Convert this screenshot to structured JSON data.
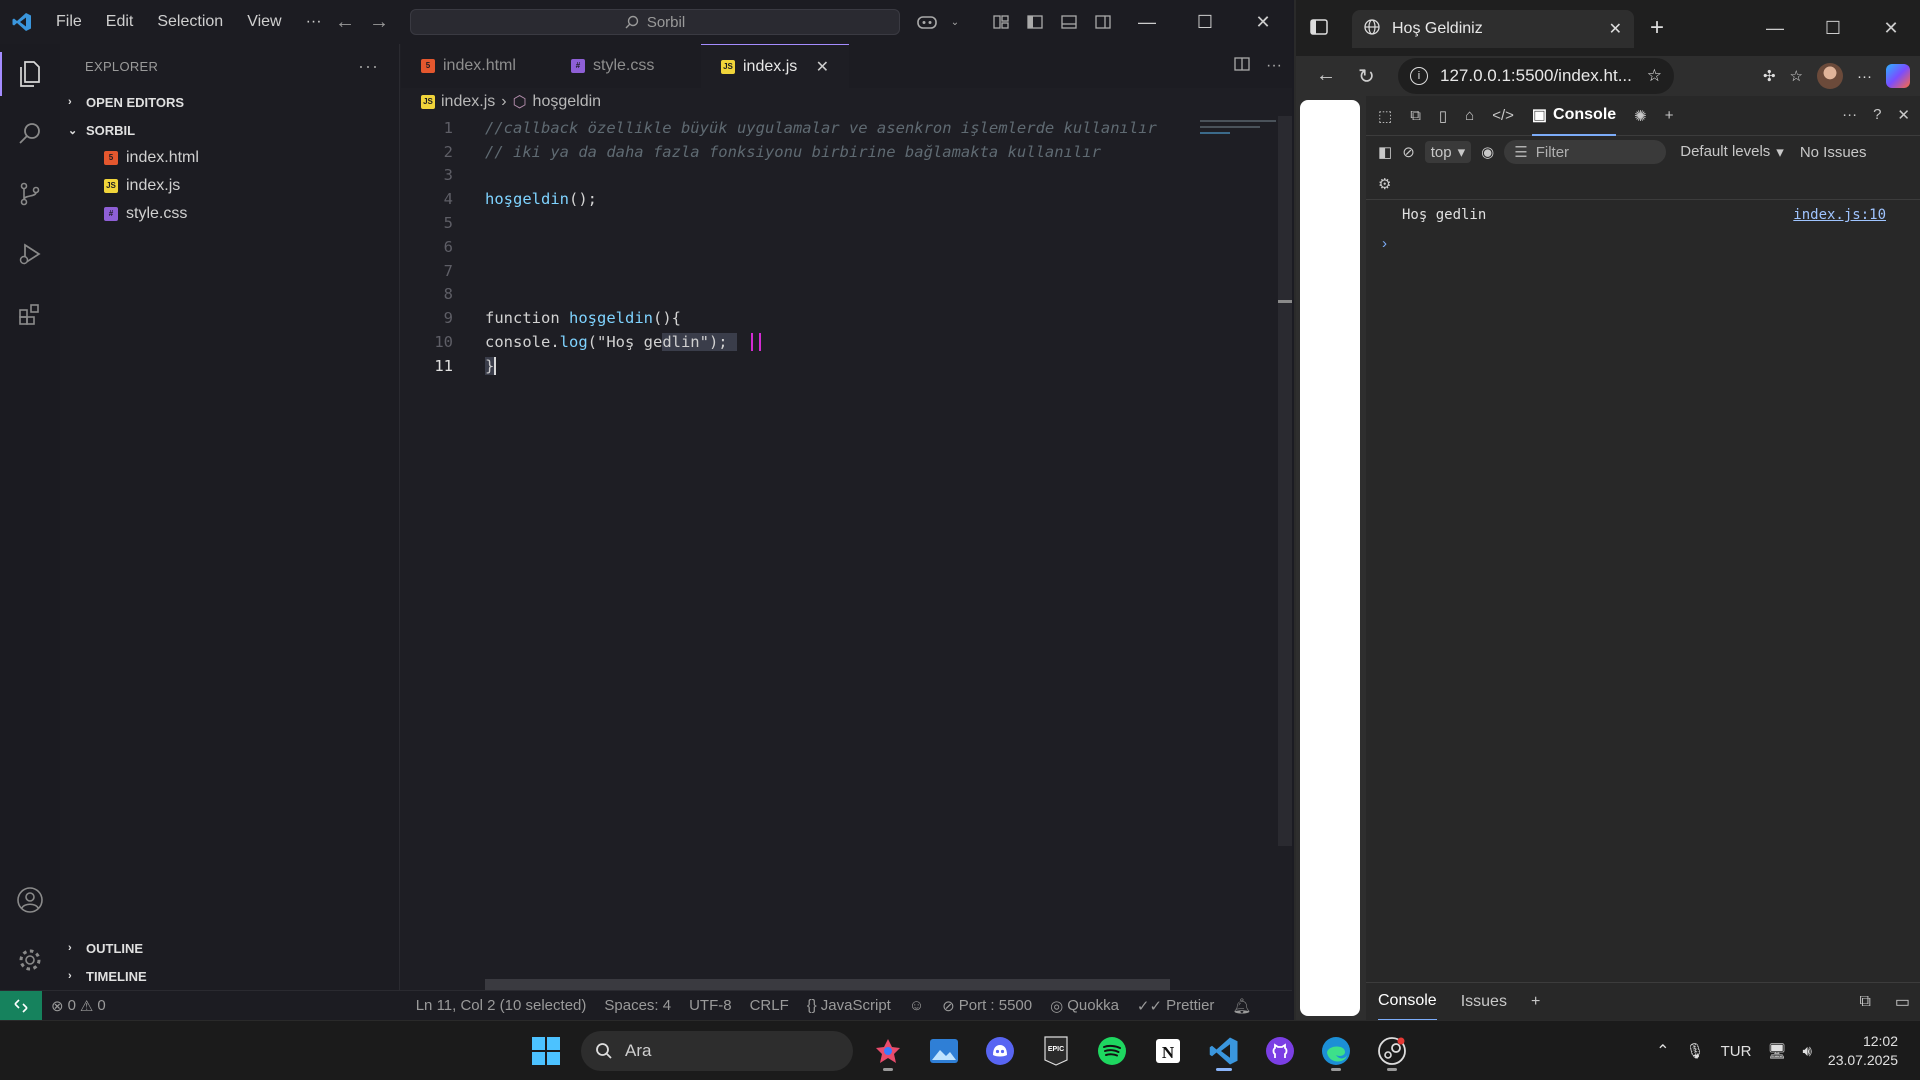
{
  "vscode": {
    "menu": [
      "File",
      "Edit",
      "Selection",
      "View",
      "···"
    ],
    "search_text": "Sorbil",
    "explorer_title": "EXPLORER",
    "sections": {
      "open_editors": "OPEN EDITORS",
      "project": "SORBIL",
      "outline": "OUTLINE",
      "timeline": "TIMELINE"
    },
    "files": [
      {
        "name": "index.html",
        "type": "html"
      },
      {
        "name": "index.js",
        "type": "js"
      },
      {
        "name": "style.css",
        "type": "css"
      }
    ],
    "tabs": [
      {
        "label": "index.html",
        "type": "html"
      },
      {
        "label": "style.css",
        "type": "css"
      },
      {
        "label": "index.js",
        "type": "js",
        "active": true
      }
    ],
    "breadcrumb": {
      "file": "index.js",
      "symbol": "hoşgeldin"
    },
    "line_numbers": [
      "1",
      "2",
      "3",
      "4",
      "5",
      "6",
      "7",
      "8",
      "9",
      "10",
      "11"
    ],
    "code": {
      "l1": "//callback özellikle büyük uygulamalar ve asenkron işlemlerde kullanılır",
      "l2": "// iki ya da daha fazla fonksiyonu birbirine bağlamakta kullanılır",
      "l4_fn": "hoşgeldin",
      "l4_rest": "();",
      "l9_kw": "function",
      "l9_fn": "hoşgeldin",
      "l9_rest": "(){",
      "l10_obj": "console.",
      "l10_method": "log",
      "l10_a": "(\"Hoş ge",
      "l10_sel": "dlin\"); ",
      "l11": "}"
    },
    "status": {
      "errors": "0",
      "warnings": "0",
      "position": "Ln 11, Col 2 (10 selected)",
      "spaces": "Spaces: 4",
      "encoding": "UTF-8",
      "eol": "CRLF",
      "language": "JavaScript",
      "port": "Port : 5500",
      "quokka": "Quokka",
      "prettier": "Prettier"
    }
  },
  "browser": {
    "tab_title": "Hoş Geldiniz",
    "url": "127.0.0.1:5500/index.ht...",
    "devtools": {
      "tab_console": "Console",
      "context": "top",
      "filter_placeholder": "Filter",
      "levels": "Default levels",
      "issues": "No Issues",
      "log_message": "Hoş gedlin",
      "log_source": "index.js:10",
      "bottom_tabs": [
        "Console",
        "Issues"
      ]
    }
  },
  "taskbar": {
    "search_label": "Ara",
    "lang": "TUR",
    "time": "12:02",
    "date": "23.07.2025"
  }
}
